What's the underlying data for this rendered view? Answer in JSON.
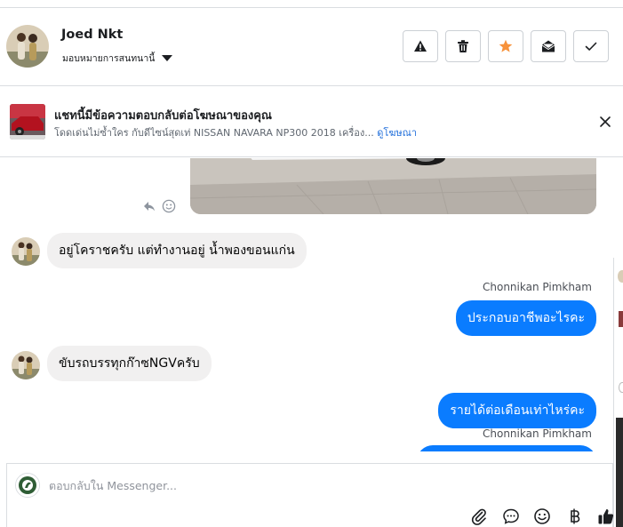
{
  "header": {
    "contact_name": "Joed Nkt",
    "assign_label": "มอบหมายการสนทนานี้",
    "actions": [
      "spam-icon",
      "trash-icon",
      "star-icon",
      "mark-unread-icon",
      "done-icon"
    ]
  },
  "ad_banner": {
    "title": "แชทนี้มีข้อความตอบกลับต่อโฆษณาของคุณ",
    "description": "โดดเด่นไม่ซ้ำใคร กับดีไซน์สุดเท่ NISSAN NAVARA NP300 2018 เครื่อง...",
    "link_label": "ดูโฆษณา"
  },
  "messages": [
    {
      "direction": "in",
      "text": "อยู่โคราชครับ แต่ทำงานอยู่ น้ำพองขอนแก่น"
    },
    {
      "direction": "out",
      "sender": "Chonnikan Pimkham",
      "text": "ประกอบอาชีพอะไรคะ"
    },
    {
      "direction": "in",
      "text": "ขับรถบรรทุกก๊าซNGVครับ"
    },
    {
      "direction": "out",
      "text": "รายได้ต่อเดือนเท่าไหร่คะ"
    },
    {
      "direction": "out",
      "sender": "Chonnikan Pimkham",
      "text": ""
    }
  ],
  "composer": {
    "placeholder": "ตอบกลับใน Messenger...",
    "tools": [
      "attachment-icon",
      "saved-reply-icon",
      "emoji-icon",
      "payment-icon",
      "like-icon"
    ]
  },
  "colors": {
    "accent": "#0a7cff",
    "star": "#f7923b",
    "incoming_bubble": "#f1f0f0"
  }
}
